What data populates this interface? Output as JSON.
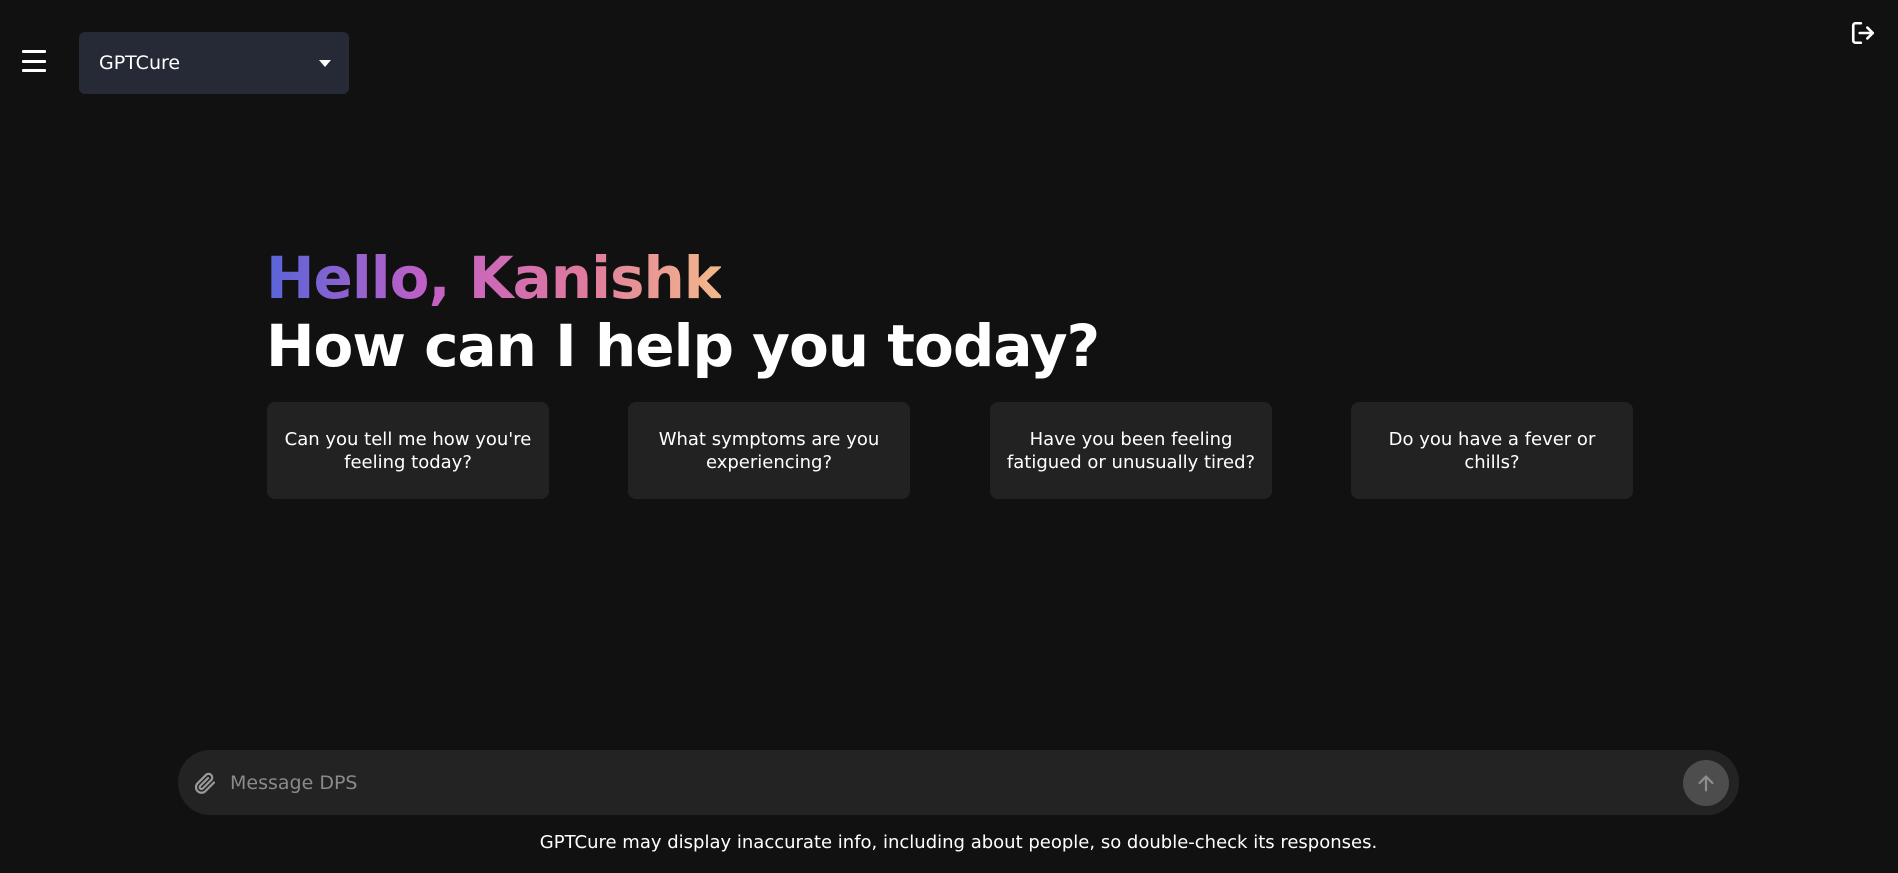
{
  "header": {
    "model_selector": {
      "label": "GPTCure"
    },
    "menu_icon": "hamburger-icon",
    "logout_icon": "logout-icon"
  },
  "hero": {
    "greeting": "Hello, Kanishk",
    "subtitle": "How can I help you today?"
  },
  "suggestions": [
    {
      "text": "Can you tell me how you're feeling today?"
    },
    {
      "text": "What symptoms are you experiencing?"
    },
    {
      "text": "Have you been feeling fatigued or unusually tired?"
    },
    {
      "text": "Do you have a fever or chills?"
    }
  ],
  "composer": {
    "placeholder": "Message DPS",
    "value": "",
    "attach_icon": "paperclip-icon",
    "send_icon": "arrow-up-icon"
  },
  "footer": {
    "disclaimer": "GPTCure may display inaccurate info, including about people, so double-check its responses."
  },
  "colors": {
    "background": "#121112",
    "card": "#222223",
    "selector": "#262a37",
    "gradient": [
      "#5865d9",
      "#c15fc6",
      "#e07a9e",
      "#f3b98a"
    ]
  }
}
